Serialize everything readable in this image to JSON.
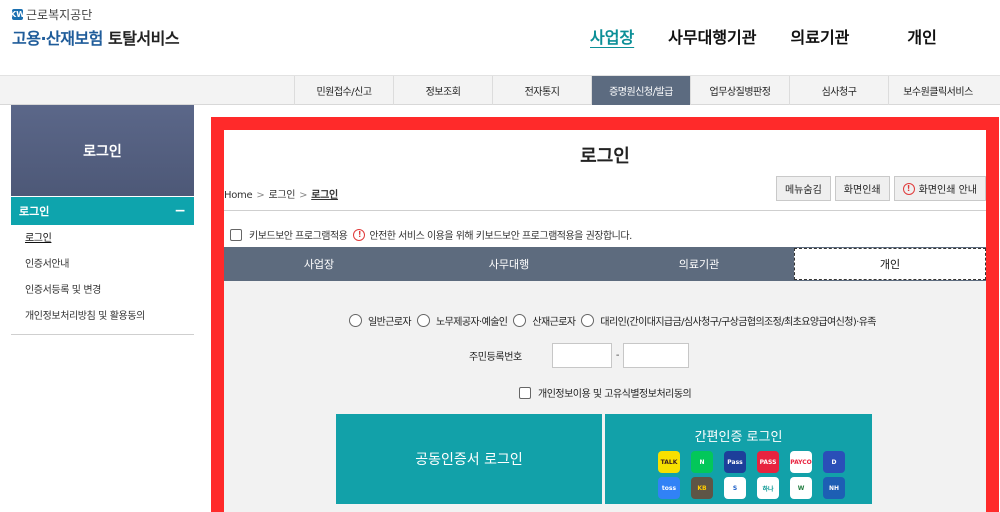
{
  "logo": {
    "org": "근로복지공단",
    "mark": "KW",
    "title_prefix": "고용·산재보험",
    "title_suffix": "토탈서비스"
  },
  "gnb": {
    "items": [
      "사업장",
      "사무대행기관",
      "의료기관",
      "개인"
    ],
    "active": "사업장"
  },
  "subnav": {
    "items": [
      "민원접수/신고",
      "정보조회",
      "전자통지",
      "증명원신청/발급",
      "업무상질병판정",
      "심사청구",
      "보수원클릭서비스"
    ],
    "active": "증명원신청/발급"
  },
  "sidebar": {
    "hero": "로그인",
    "bar_label": "로그인",
    "bar_toggle": "−",
    "links": [
      "로그인",
      "인증서안내",
      "인증서등록 및 변경",
      "개인정보처리방침 및 활용동의"
    ]
  },
  "main": {
    "title": "로그인",
    "breadcrumb": [
      "Home",
      "로그인",
      "로그인"
    ],
    "buttons": {
      "menu_hide": "메뉴숨김",
      "print": "화면인쇄",
      "print_guide": "화면인쇄 안내"
    },
    "keyboard": {
      "label": "키보드보안 프로그램적용",
      "notice": "안전한 서비스 이용을 위해 키보드보안 프로그램적용을 권장합니다."
    },
    "tabs": [
      "사업장",
      "사무대행",
      "의료기관",
      "개인"
    ],
    "active_tab": "개인",
    "radios": [
      "일반근로자",
      "노무제공자·예술인",
      "산재근로자",
      "대리인(간이대지급금/심사청구/구상금협의조정/최초요양급여신청)·유족"
    ],
    "rrn_label": "주민등록번호",
    "rrn_dash": "-",
    "agree_label": "개인정보이용 및 고유식별정보처리동의",
    "cert_login": "공동인증서 로그인",
    "simple_login": "간편인증 로그인",
    "simple_icons": [
      {
        "name": "kakao-icon",
        "text": "TALK",
        "bg": "#f7e000",
        "fg": "#3a1d1d"
      },
      {
        "name": "naver-icon",
        "text": "N",
        "bg": "#03c75a",
        "fg": "#ffffff"
      },
      {
        "name": "samsung-pass-icon",
        "text": "Pass",
        "bg": "#1d3f9a",
        "fg": "#ffffff"
      },
      {
        "name": "pass-icon",
        "text": "PASS",
        "bg": "#e8233f",
        "fg": "#ffffff"
      },
      {
        "name": "payco-icon",
        "text": "PAYCO",
        "bg": "#ffffff",
        "fg": "#e8233f"
      },
      {
        "name": "dream-shield-icon",
        "text": "D",
        "bg": "#2a4fb8",
        "fg": "#ffffff"
      },
      {
        "name": "toss-icon",
        "text": "toss",
        "bg": "#3182f6",
        "fg": "#ffffff"
      },
      {
        "name": "kb-icon",
        "text": "KB",
        "bg": "#5e5546",
        "fg": "#ffcc00"
      },
      {
        "name": "shinhan-icon",
        "text": "S",
        "bg": "#ffffff",
        "fg": "#1a5dc8"
      },
      {
        "name": "hana-icon",
        "text": "하나",
        "bg": "#ffffff",
        "fg": "#009490"
      },
      {
        "name": "woori-icon",
        "text": "W",
        "bg": "#ffffff",
        "fg": "#1e7a3c"
      },
      {
        "name": "nh-icon",
        "text": "NH",
        "bg": "#1d5fb4",
        "fg": "#ffffff"
      }
    ]
  }
}
